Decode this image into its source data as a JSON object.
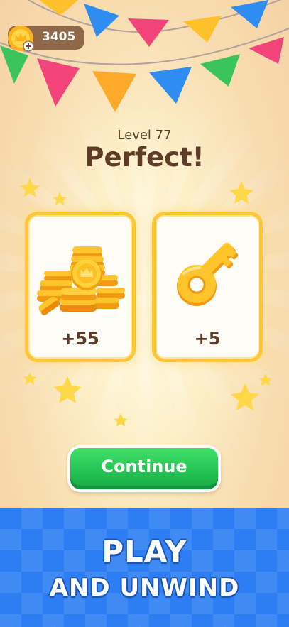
{
  "header": {
    "coin_balance": "3405"
  },
  "result": {
    "level_label": "Level 77",
    "title": "Perfect!"
  },
  "rewards": [
    {
      "type": "coins",
      "icon": "coin-stack-icon",
      "amount": "+55"
    },
    {
      "type": "key",
      "icon": "key-icon",
      "amount": "+5"
    }
  ],
  "continue_button": {
    "label": "Continue"
  },
  "promo": {
    "line1": "PLAY",
    "line2": "AND UNWIND"
  },
  "colors": {
    "accent_gold": "#ffc535",
    "button_green": "#22c152",
    "banner_blue": "#2d7ef2",
    "text_brown": "#5f3c28"
  }
}
